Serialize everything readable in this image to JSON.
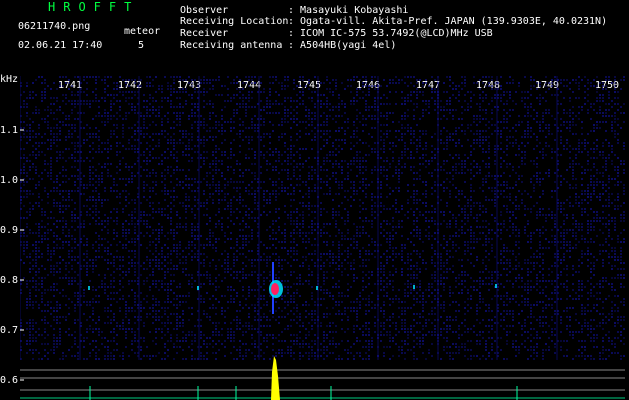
{
  "header": {
    "app_title": "HROFFT",
    "filename": "06211740.png",
    "datetime": "02.06.21 17:40",
    "detection_label": "meteor",
    "detection_count": "5"
  },
  "info": [
    {
      "label": "Observer",
      "value": ": Masayuki Kobayashi"
    },
    {
      "label": "Receiving Location",
      "value": ": Ogata-vill. Akita-Pref. JAPAN (139.9303E, 40.0231N)"
    },
    {
      "label": "Receiver",
      "value": ": ICOM IC-575 53.7492(@LCD)MHz USB"
    },
    {
      "label": "Receiving antenna",
      "value": ": A504HB(yagi 4el)"
    }
  ],
  "axes": {
    "unit_label": "kHz",
    "time_ticks": [
      "1741",
      "1742",
      "1743",
      "1744",
      "1745",
      "1746",
      "1747",
      "1748",
      "1749",
      "1750"
    ],
    "freq_ticks": [
      "1.1",
      "1.0",
      "0.9",
      "0.8",
      "0.7",
      "0.6"
    ]
  },
  "colors": {
    "title": "#00ff40",
    "background": "#000000",
    "noise": "#10108a",
    "echo_core": "#ff2060",
    "echo_halo": "#00e0ff",
    "level_plot": "#ffff00",
    "level_baseline": "#00ffa0"
  }
}
